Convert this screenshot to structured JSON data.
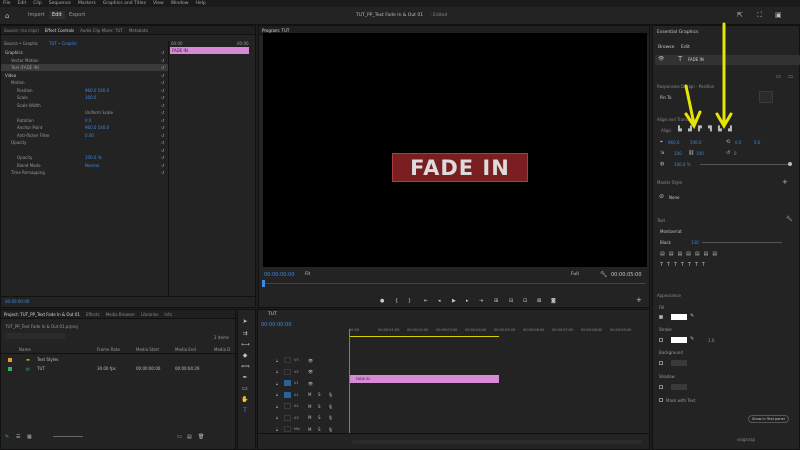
{
  "menu": [
    "File",
    "Edit",
    "Clip",
    "Sequence",
    "Markers",
    "Graphics and Titles",
    "View",
    "Window",
    "Help"
  ],
  "workspace": {
    "tabs": [
      "Import",
      "Edit",
      "Export"
    ],
    "active": "Edit",
    "title": "TUT_PP_Text Fade In & Out 01",
    "status": "- Edited"
  },
  "effect_controls": {
    "tabs": [
      "Source: (no clips)",
      "Effect Controls",
      "Audio Clip Mixer: TUT",
      "Metadata"
    ],
    "active": "Effect Controls",
    "source": "Source • Graphic",
    "seq": "TUT • Graphic",
    "time_left": "00:00",
    "time_right": "00:00",
    "clip_label": "FADE IN",
    "rows": [
      {
        "label": "Graphics",
        "val": "",
        "indent": 0
      },
      {
        "label": "Vector Motion",
        "val": "",
        "indent": 1
      },
      {
        "label": "Text (FADE IN)",
        "val": "",
        "indent": 1,
        "sel": true
      },
      {
        "label": "Video",
        "val": "",
        "indent": 0
      },
      {
        "label": "Motion",
        "val": "",
        "indent": 1
      },
      {
        "label": "Position",
        "val": "960.0   540.0",
        "indent": 2
      },
      {
        "label": "Scale",
        "val": "100.0",
        "indent": 2
      },
      {
        "label": "Scale Width",
        "val": "",
        "indent": 2
      },
      {
        "label": "",
        "val": "Uniform Scale",
        "indent": 2
      },
      {
        "label": "Rotation",
        "val": "0.0",
        "indent": 2
      },
      {
        "label": "Anchor Point",
        "val": "960.0   540.0",
        "indent": 2
      },
      {
        "label": "Anti-flicker Filter",
        "val": "0.00",
        "indent": 2
      },
      {
        "label": "Opacity",
        "val": "",
        "indent": 1
      },
      {
        "label": "",
        "val": "",
        "indent": 2
      },
      {
        "label": "Opacity",
        "val": "100.0 %",
        "indent": 2
      },
      {
        "label": "Blend Mode",
        "val": "Normal",
        "indent": 2
      },
      {
        "label": "Time Remapping",
        "val": "",
        "indent": 1
      }
    ],
    "footer_tc": "00:00:00:00"
  },
  "program": {
    "title": "Program: TUT",
    "text": "FADE IN",
    "timecode": "00:00:00:00",
    "fit": "Fit",
    "quality": "Full",
    "duration": "00:00:05:00"
  },
  "project": {
    "tabs": [
      "Project: TUT_PP_Text Fade In & Out 01",
      "Effects",
      "Media Browser",
      "Libraries",
      "Info"
    ],
    "file": "TUT_PP_Text Fade In & Out 01.prproj",
    "count": "2 items",
    "headers": [
      "Name",
      "Frame Rate",
      "Media Start",
      "Media End",
      "Media D"
    ],
    "items": [
      {
        "name": "Text Styles",
        "rate": "",
        "start": "",
        "end": "",
        "color": "#e0a030"
      },
      {
        "name": "TUT",
        "rate": "30.00 fps",
        "start": "00:00:00:00",
        "end": "00:00:04:29",
        "color": "#38b060"
      }
    ]
  },
  "timeline": {
    "title": "TUT",
    "timecode": "00:00:00:00",
    "ruler": [
      "00:00",
      "00:00:01:00",
      "00:00:02:00",
      "00:00:03:00",
      "00:00:04:00",
      "00:00:05:00",
      "00:00:06:00",
      "00:00:07:00",
      "00:00:08:00",
      "00:00:09:00"
    ],
    "tracks": [
      "V3",
      "V2",
      "V1",
      "A1",
      "A2",
      "A3",
      "Mix"
    ],
    "clip": "FADE IN",
    "mix_val": "0.0"
  },
  "essential_graphics": {
    "title": "Essential Graphics",
    "tabs": [
      "Browse",
      "Edit"
    ],
    "layer": "FADE IN",
    "responsive_label": "Responsive Design - Position",
    "pin": "Pin To",
    "align_label": "Align and Transform",
    "align": "Align",
    "pos_x": "960.0",
    "pos_y": "540.0",
    "rot": "0.0",
    "rot2": "0.0",
    "scale": "100",
    "scale2": "100",
    "opacity": "100.0 %",
    "master_style": "Master Style",
    "none": "None",
    "text_label": "Text",
    "font": "Montserrat",
    "weight": "Black",
    "size": "130",
    "appearance": "Appearance",
    "fill": "Fill",
    "stroke": "Stroke",
    "stroke_val": "1.0",
    "background": "Background",
    "shadow": "Shadow",
    "mask": "Mask with Text",
    "show_text": "Show in Text panel"
  },
  "colors": {
    "accent": "#3d8ae0",
    "clip_pink": "#d68ad6",
    "fade_bg": "#7a1e22",
    "arrow": "#e6e600"
  }
}
